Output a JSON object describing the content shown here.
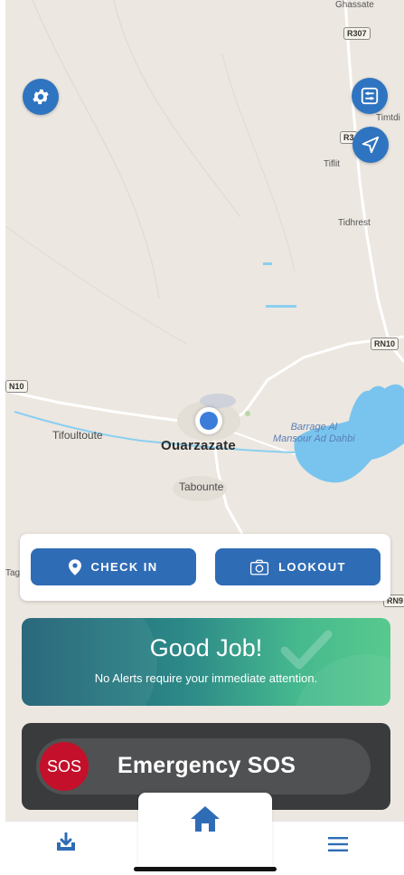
{
  "map": {
    "labels": {
      "ghassate": "Ghassate",
      "timtdi": "Timtdi",
      "tiflit": "Tiflit",
      "tidhrest": "Tidhrest",
      "tifoultoute": "Tifoultoute",
      "ouarzazate": "Ouarzazate",
      "tabounte": "Tabounte",
      "barrage": "Barrage Al",
      "barrage2": "Mansour Ad Dahbi",
      "tag": "Tag"
    },
    "shields": {
      "r307": "R307",
      "r3": "R3",
      "rn10_right": "RN10",
      "rn10_left": "N10",
      "rn9": "RN9"
    }
  },
  "actions": {
    "check_in": "CHECK IN",
    "lookout": "LOOKOUT"
  },
  "status": {
    "title": "Good Job!",
    "subtitle": "No Alerts require your immediate attention."
  },
  "sos": {
    "knob": "SOS",
    "label": "Emergency SOS"
  },
  "nav": {
    "left_icon": "download-icon",
    "center_icon": "home-icon",
    "right_icon": "menu-icon"
  },
  "colors": {
    "primary": "#2f6cb6",
    "fab": "#2f74c0",
    "sos_red": "#c4102a",
    "water": "#79c4ee"
  }
}
